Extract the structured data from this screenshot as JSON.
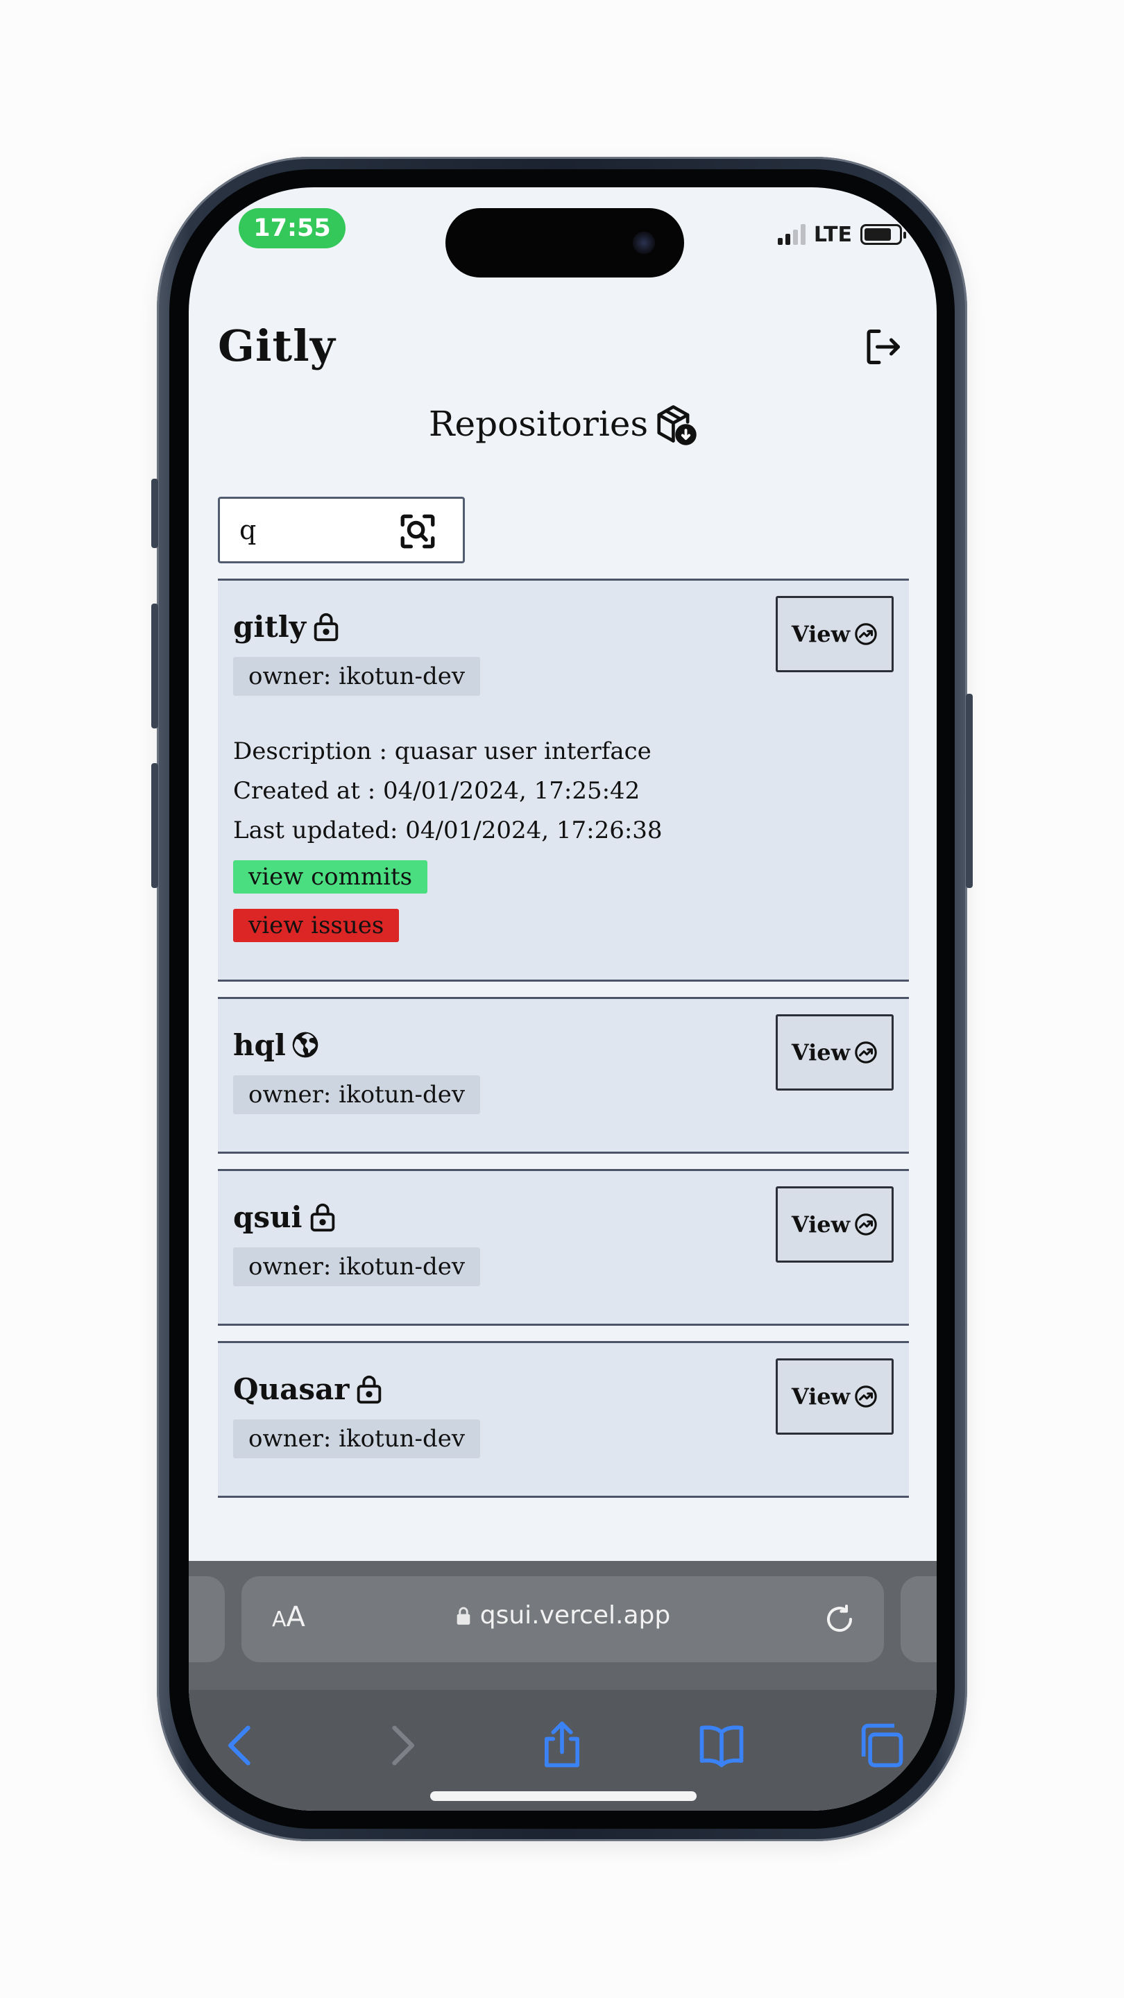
{
  "status_bar": {
    "time": "17:55",
    "network": "LTE"
  },
  "app": {
    "title": "Gitly"
  },
  "page": {
    "heading": "Repositories"
  },
  "search": {
    "value": "q"
  },
  "repositories": [
    {
      "name": "gitly",
      "visibility_icon": "lock-icon",
      "owner": "owner: ikotun-dev",
      "view_label": "View",
      "expanded": true,
      "description": "Description : quasar user interface",
      "created_at": "Created at : 04/01/2024, 17:25:42",
      "last_updated": "Last updated: 04/01/2024, 17:26:38",
      "commits_label": "view commits",
      "issues_label": "view issues"
    },
    {
      "name": "hql",
      "visibility_icon": "globe-icon",
      "owner": "owner: ikotun-dev",
      "view_label": "View"
    },
    {
      "name": "qsui",
      "visibility_icon": "lock-icon",
      "owner": "owner: ikotun-dev",
      "view_label": "View"
    },
    {
      "name": "Quasar",
      "visibility_icon": "lock-icon",
      "owner": "owner: ikotun-dev",
      "view_label": "View"
    }
  ],
  "browser": {
    "text_size_small": "A",
    "text_size_large": "A",
    "url": "qsui.vercel.app"
  },
  "colors": {
    "status_time_bg": "#34c759",
    "card_bg": "#e0e6ef",
    "commits_tag": "#4ade80",
    "issues_tag": "#dc2626",
    "browser_accent": "#3b82f6"
  }
}
